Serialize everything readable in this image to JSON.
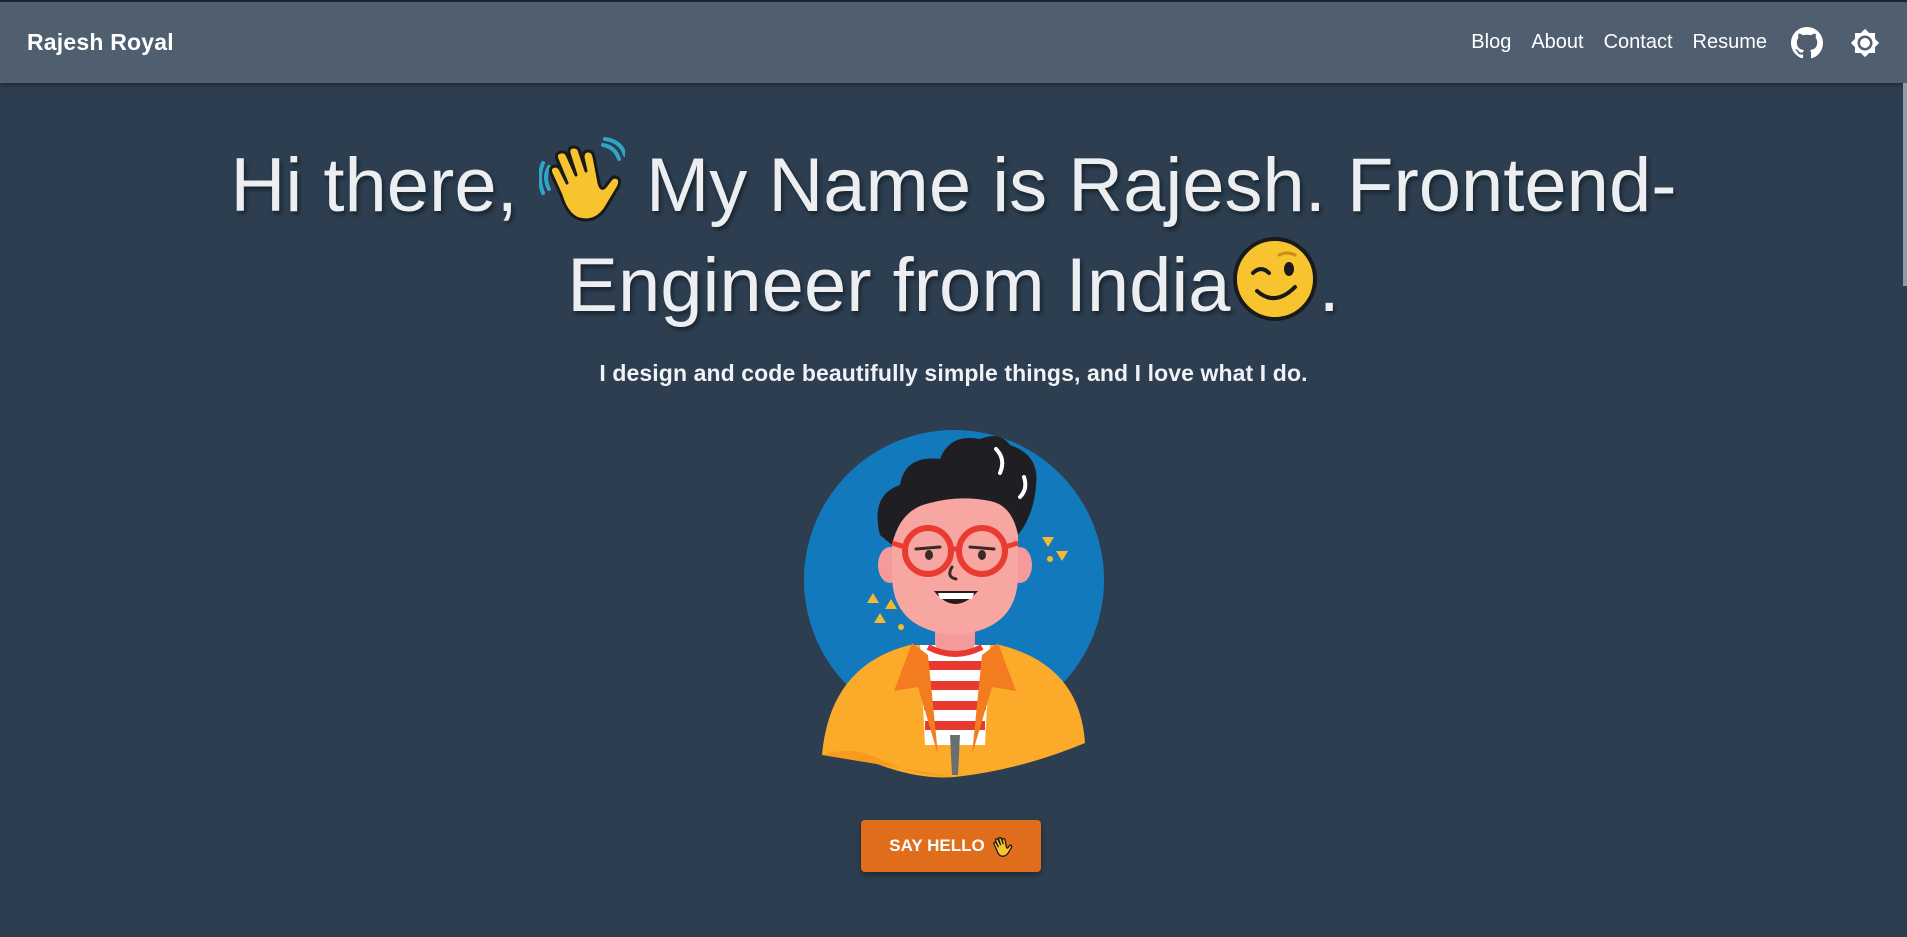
{
  "nav": {
    "brand": "Rajesh Royal",
    "links": [
      {
        "label": "Blog"
      },
      {
        "label": "About"
      },
      {
        "label": "Contact"
      },
      {
        "label": "Resume"
      }
    ],
    "icons": [
      "github-icon",
      "theme-toggle-icon"
    ]
  },
  "hero": {
    "title_part1": "Hi there,",
    "title_part2": "My Name is Rajesh. Frontend-",
    "title_part3": "Engineer from India",
    "title_part4": ".",
    "emoji_wave": "waving-hand-emoji",
    "emoji_wink": "winking-face-emoji",
    "subtitle": "I design and code beautifully simple things, and I love what I do.",
    "cta_label": "SAY HELLO"
  },
  "colors": {
    "background": "#2c3e50",
    "navbar": "#4f5f70",
    "accent_button": "#e06d1c",
    "avatar_circle": "#1279bc"
  }
}
